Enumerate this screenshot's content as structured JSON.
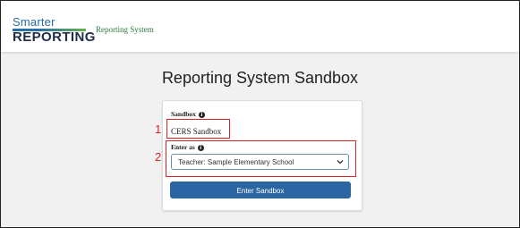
{
  "header": {
    "logo_top": "Smarter",
    "logo_bottom": "REPORTING",
    "system_name": "Reporting System"
  },
  "page_title": "Reporting System Sandbox",
  "form": {
    "sandbox_label": "Sandbox",
    "sandbox_value": "CERS Sandbox",
    "enter_as_label": "Enter as",
    "enter_as_selected": "Teacher: Sample Elementary School",
    "submit_label": "Enter Sandbox"
  },
  "annotations": {
    "callout_1": "1",
    "callout_2": "2"
  },
  "colors": {
    "brand_blue": "#2b64a2",
    "brand_green": "#2e7a3a",
    "annotation_red": "#d22"
  }
}
